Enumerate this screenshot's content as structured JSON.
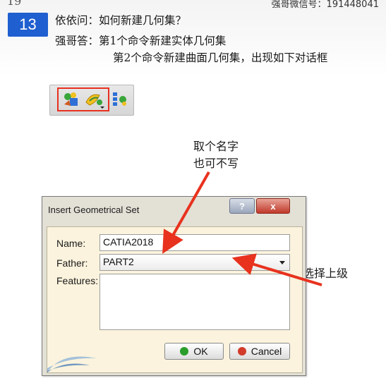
{
  "header": {
    "top_mark": "19",
    "wechat": "强哥微信号：191448041",
    "badge": "13",
    "question": "依依问：如何新建几何集？",
    "answer_line1": "强哥答：第1个命令新建实体几何集",
    "answer_line2": "第2个命令新建曲面几何集，出现如下对话框"
  },
  "toolbar": {
    "icons": [
      "geometrical-set-icon",
      "ordered-geometrical-set-icon",
      "geometrical-set-variant-icon"
    ]
  },
  "annotations": {
    "name_note_line1": "取个名字",
    "name_note_line2": "也可不写",
    "father_note": "选择上级",
    "arrow_color": "#e8321e"
  },
  "dialog": {
    "title": "Insert Geometrical Set",
    "help_label": "?",
    "close_label": "x",
    "name_label": "Name:",
    "name_value": "CATIA2018",
    "father_label": "Father:",
    "father_value": "PART2",
    "features_label": "Features:",
    "ok_label": "OK",
    "cancel_label": "Cancel",
    "ok_color": "#2a9d2a",
    "cancel_color": "#d23b2a"
  }
}
